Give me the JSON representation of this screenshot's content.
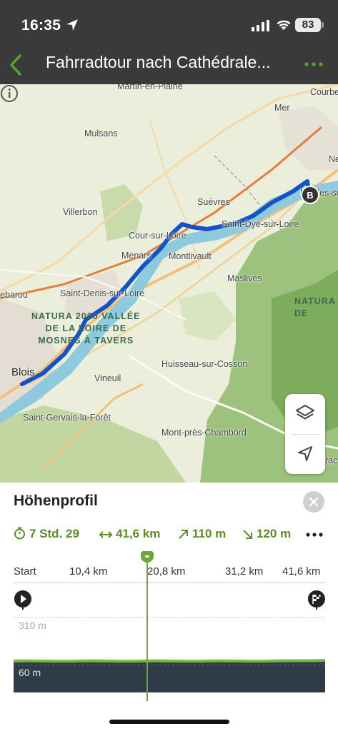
{
  "status_bar": {
    "time": "16:35",
    "battery": "83"
  },
  "header": {
    "title": "Fahrradtour nach Cathédrale...",
    "accent_color": "#5ba42e"
  },
  "map": {
    "labels": {
      "martin": "Martin-en-Plaine",
      "courbe": "Courbe",
      "mer": "Mer",
      "mulsans": "Mulsans",
      "ne": "Ne",
      "muides": "Muides-sur-Loi",
      "suevres": "Suèvres",
      "villerbon": "Villerbon",
      "cour": "Cour-sur-Loire",
      "saint_dye": "Saint-Dyé-sur-Loire",
      "menars": "Menars",
      "montlivault": "Montlivault",
      "maslives": "Maslives",
      "ebarou": "ebarou",
      "saint_denis": "Saint-Denis-sur-Loire",
      "natura_right": "NATURA\nDE",
      "vineuil": "Vineuil",
      "huisseau": "Huisseau-sur-Cosson",
      "blois": "Blois",
      "saint_gervais": "Saint-Gervais-la-Forêt",
      "mont_pres": "Mont-près-Chambord",
      "rac": "rac"
    },
    "natura_zone": "NATURA 2000 VALLÉE\nDE LA LOIRE DE\nMOSNES À TAVERS",
    "end_marker": "B",
    "route_color": "#1552c8"
  },
  "elevation": {
    "title": "Höhenprofil",
    "duration": "7 Std. 29",
    "distance": "41,6 km",
    "ascent": "110 m",
    "descent": "120 m",
    "axis_ticks": [
      "Start",
      "10,4 km",
      "20,8 km",
      "31,2 km",
      "41,6 km"
    ],
    "elev_max": "310 m",
    "elev_min": "60 m",
    "marker_fraction": 0.43
  }
}
